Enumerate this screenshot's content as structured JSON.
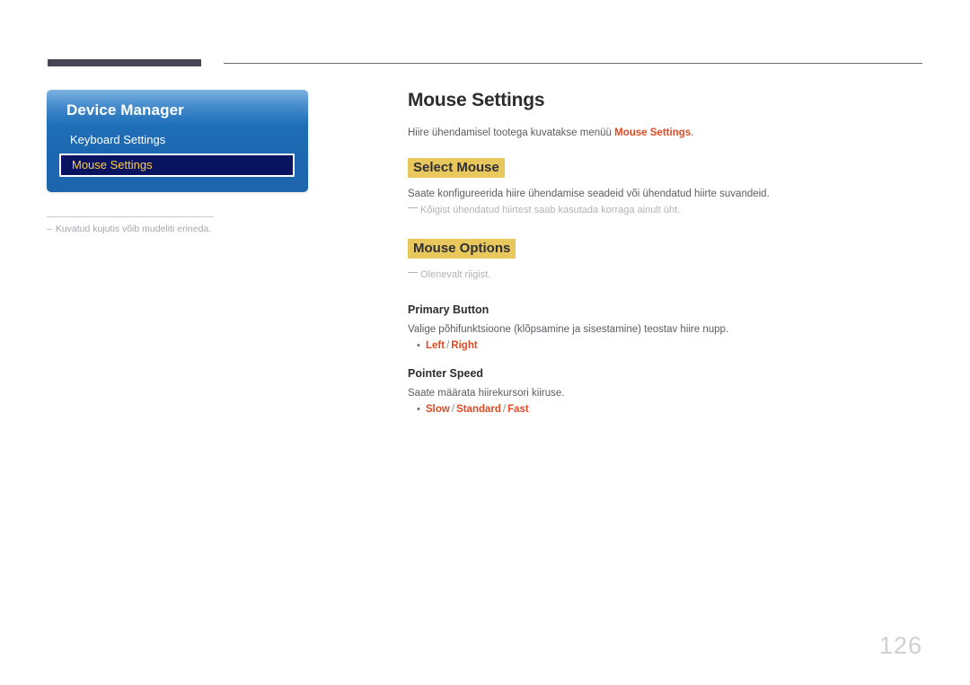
{
  "header": {
    "bar_color": "#474554",
    "line_color": "#6b6a75"
  },
  "osd": {
    "title": "Device Manager",
    "items": [
      {
        "label": "Keyboard Settings",
        "selected": false
      },
      {
        "label": "Mouse Settings",
        "selected": true
      }
    ],
    "selected_text_color": "#ffcf4d",
    "panel_color": "#1f6fb8",
    "selected_bg": "#0a1360"
  },
  "panel_note": {
    "dash": "–",
    "text": "Kuvatud kujutis võib mudeliti erineda."
  },
  "content": {
    "title": "Mouse Settings",
    "intro_before": "Hiire ühendamisel tootega kuvatakse menüü ",
    "intro_keyword": "Mouse Settings",
    "intro_after": ".",
    "sections": [
      {
        "heading": "Select Mouse",
        "body": "Saate konfigureerida hiire ühendamise seadeid või ühendatud hiirte suvandeid.",
        "note": "Kõigist ühendatud hiirtest saab kasutada korraga ainult üht."
      },
      {
        "heading": "Mouse Options",
        "note": "Olenevalt riigist."
      }
    ],
    "subsections": [
      {
        "heading": "Primary Button",
        "body": "Valige põhifunktsioone (klõpsamine ja sisestamine) teostav hiire nupp.",
        "bullet_marker": "•",
        "options": [
          "Left",
          "Right"
        ],
        "option_separator": "/"
      },
      {
        "heading": "Pointer Speed",
        "body": "Saate määrata hiirekursori kiiruse.",
        "bullet_marker": "•",
        "options": [
          "Slow",
          "Standard",
          "Fast"
        ],
        "option_separator": "/"
      }
    ],
    "highlight_color": "#e8c75c",
    "keyword_color": "#e04a25"
  },
  "footer": {
    "page_number": "126"
  }
}
